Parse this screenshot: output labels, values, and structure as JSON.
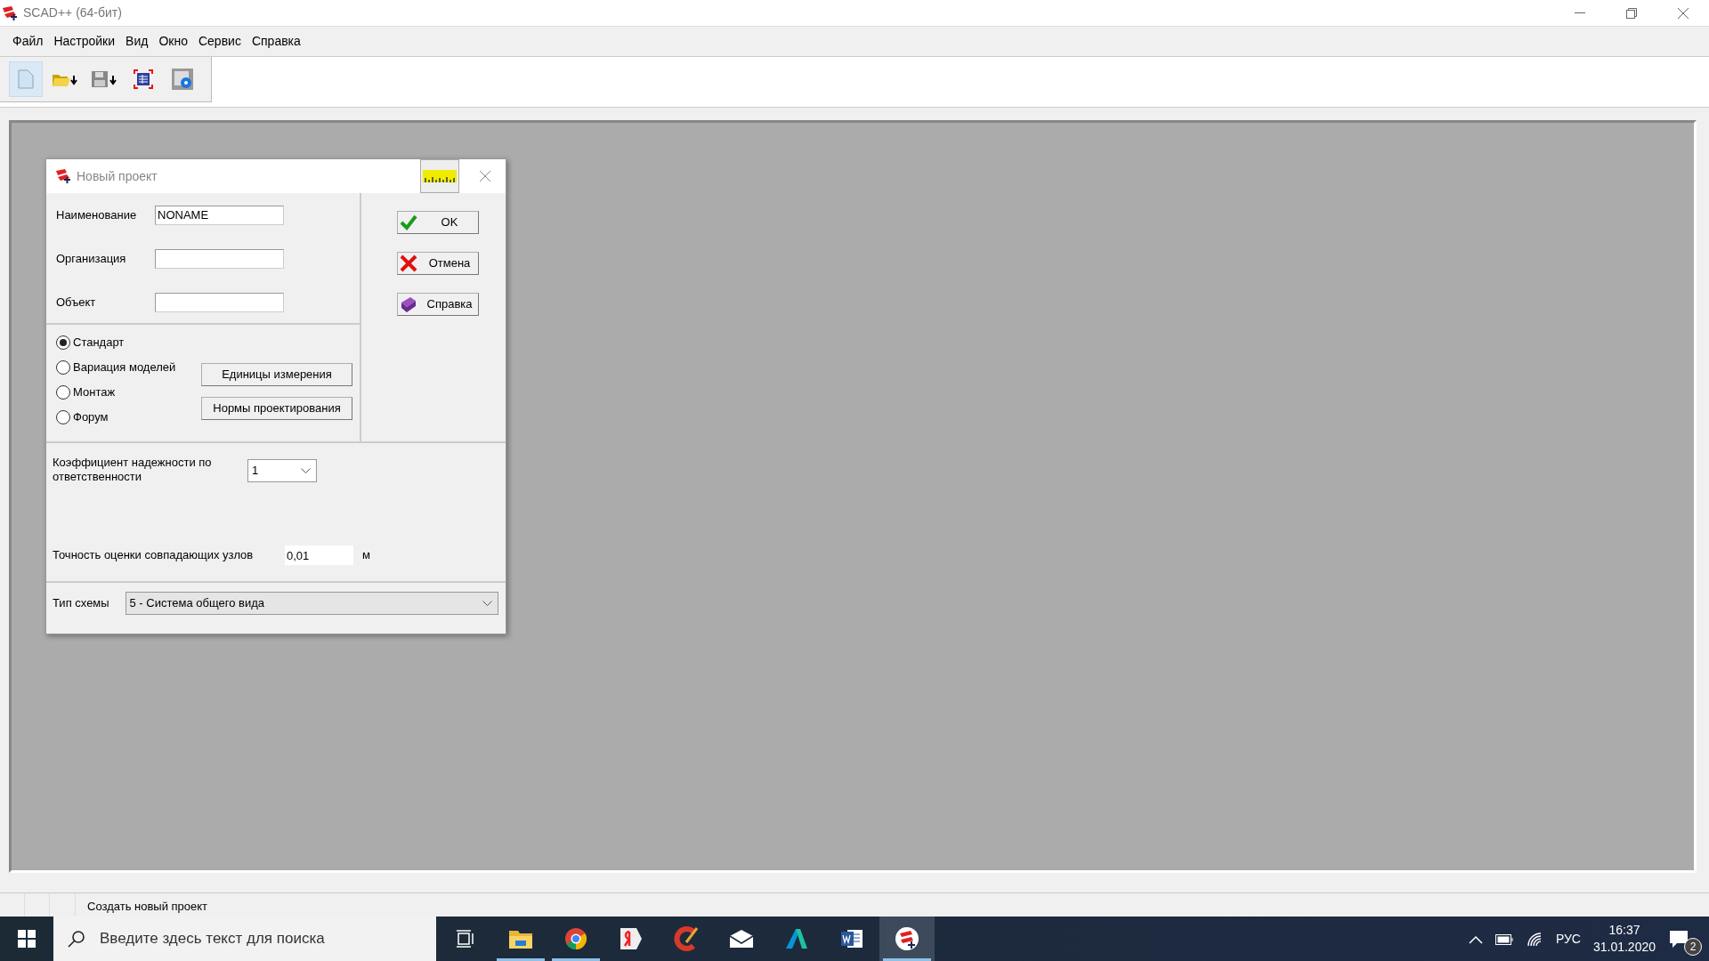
{
  "app": {
    "title": "SCAD++ (64-бит)"
  },
  "menu": [
    "Файл",
    "Настройки",
    "Вид",
    "Окно",
    "Сервис",
    "Справка"
  ],
  "dialog": {
    "title": "Новый проект",
    "fields": [
      {
        "label": "Наименование",
        "value": "NONAME"
      },
      {
        "label": "Организация"
      },
      {
        "label": "Объект"
      }
    ],
    "modes": [
      {
        "label": "Стандарт",
        "selected": true
      },
      {
        "label": "Вариация моделей",
        "selected": false
      },
      {
        "label": "Монтаж",
        "selected": false
      },
      {
        "label": "Форум",
        "selected": false
      }
    ],
    "side_buttons": [
      "Единицы измерения",
      "Нормы проектирования"
    ],
    "buttons": [
      {
        "kind": "ok",
        "label": "OK"
      },
      {
        "kind": "cancel",
        "label": "Отмена"
      },
      {
        "kind": "help",
        "label": "Справка"
      }
    ],
    "reliability": {
      "label": "Коэффициент надежности по ответственности",
      "value": "1"
    },
    "tolerance": {
      "label": "Точность оценки совпадающих узлов",
      "value": "0,01",
      "unit": "м"
    },
    "scheme": {
      "label": "Тип схемы",
      "value": "5 - Система общего вида"
    }
  },
  "status_bar": {
    "text": "Создать новый проект"
  },
  "taskbar": {
    "search_placeholder": "Введите здесь текст для поиска",
    "apps": [
      {
        "kind": "task-view",
        "running": false,
        "selected": false
      },
      {
        "kind": "folder",
        "running": true,
        "selected": false
      },
      {
        "kind": "chrome",
        "running": true,
        "selected": false
      },
      {
        "kind": "yandex",
        "running": false,
        "selected": false
      },
      {
        "kind": "cleaner",
        "running": false,
        "selected": false
      },
      {
        "kind": "mail",
        "running": false,
        "selected": false
      },
      {
        "kind": "triangle",
        "running": false,
        "selected": false
      },
      {
        "kind": "word",
        "running": false,
        "selected": false
      },
      {
        "kind": "scad",
        "running": true,
        "selected": true
      }
    ],
    "language": "РУС",
    "time": "16:37",
    "date": "31.01.2020",
    "notifications": "2"
  }
}
